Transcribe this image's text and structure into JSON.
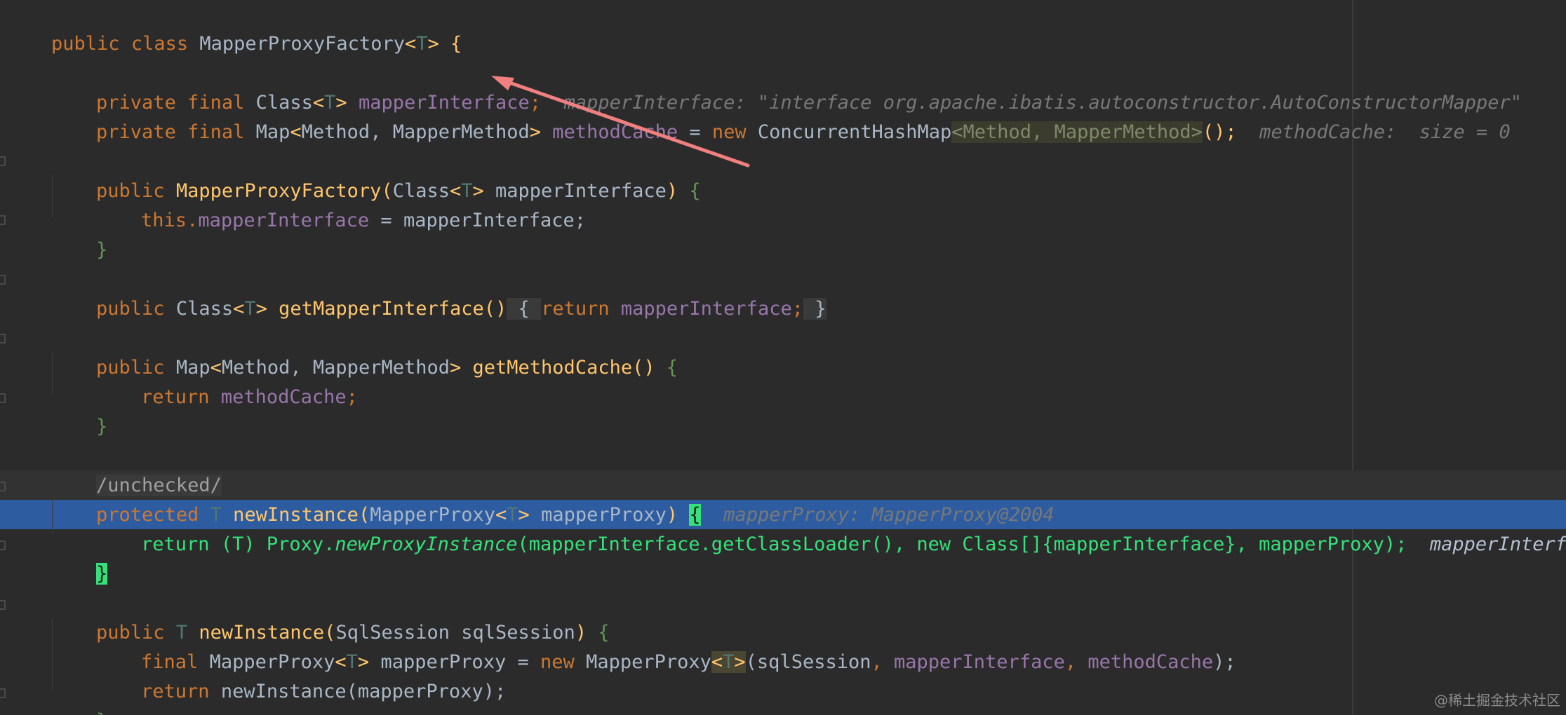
{
  "editor": {
    "colors": {
      "background": "#2b2b2b",
      "keyword": "#cc7832",
      "type": "#a9b7c6",
      "type_param": "#507874",
      "field": "#9876aa",
      "method": "#ffc66d",
      "hint": "#787878",
      "execution_line": "#2d5ca0",
      "execution_text": "#36e07a",
      "annotation_arrow": "#f08080"
    },
    "lines": {
      "class_decl": {
        "kw": "public class ",
        "name": "MapperProxyFactory",
        "lt": "<",
        "tparam": "T",
        "gt": ">",
        "rest": " {"
      },
      "field_iface": {
        "kw": "private final ",
        "type": "Class",
        "lt": "<",
        "tparam": "T",
        "gt": ">",
        "space": " ",
        "field": "mapperInterface",
        "semi": ";",
        "hint": "  mapperInterface: \"interface org.apache.ibatis.autoconstructor.AutoConstructorMapper\""
      },
      "field_cache": {
        "kw": "private final ",
        "type": "Map",
        "lt": "<",
        "type_args": "Method, MapperMethod",
        "gt": ">",
        "space": " ",
        "field": "methodCache",
        "eq": " = ",
        "new_kw": "new ",
        "ctor": "ConcurrentHashMap",
        "gen_args": "<Method, MapperMethod>",
        "tail": "();",
        "hint": "  methodCache:  size = 0"
      },
      "ctor_decl": {
        "kw": "public ",
        "name": "MapperProxyFactory",
        "open": "(",
        "ptype": "Class",
        "lt": "<",
        "tparam": "T",
        "gt": ">",
        "pname": " mapperInterface",
        "close": ") ",
        "brace": "{"
      },
      "ctor_body": {
        "this_kw": "this",
        "dot": ".",
        "field": "mapperInterface",
        "rest": " = mapperInterface;"
      },
      "ctor_end": {
        "brace": "}"
      },
      "getter_iface": {
        "kw": "public ",
        "type": "Class",
        "lt": "<",
        "tparam": "T",
        "gt": ">",
        "space": " ",
        "name": "getMapperInterface",
        "parens": "()",
        "fold_open": " { ",
        "ret_kw": "return ",
        "field": "mapperInterface",
        "semi": ";",
        "fold_close": " }"
      },
      "getter_cache": {
        "kw": "public ",
        "type": "Map",
        "lt": "<",
        "type_args": "Method, MapperMethod",
        "gt": ">",
        "space": " ",
        "name": "getMethodCache",
        "parens": "() ",
        "brace": "{"
      },
      "getter_cache_body": {
        "ret_kw": "return ",
        "field": "methodCache",
        "semi": ";"
      },
      "getter_cache_end": {
        "brace": "}"
      },
      "suppress": {
        "text": "/unchecked/"
      },
      "new_instance_1": {
        "kw": "protected ",
        "tparam": "T",
        "space": " ",
        "name": "newInstance",
        "open": "(",
        "ptype": "MapperProxy",
        "lt": "<",
        "tparam2": "T",
        "gt": ">",
        "pname": " mapperProxy",
        "close": ") ",
        "brace": "{",
        "hint": "  mapperProxy: MapperProxy@2004"
      },
      "exec_line": {
        "pre": "return (T) Proxy.",
        "method": "newProxyInstance",
        "post": "(mapperInterface.getClassLoader(), new Class[]{mapperInterface}, mapperProxy);",
        "hint": "  mapperInterface: \""
      },
      "new_instance_1_end": {
        "brace": "}"
      },
      "new_instance_2": {
        "kw": "public ",
        "tparam": "T",
        "space": " ",
        "name": "newInstance",
        "open": "(",
        "ptype": "SqlSession sqlSession",
        "close": ") ",
        "brace": "{"
      },
      "new_instance_2_body1": {
        "kw": "final ",
        "type": "MapperProxy",
        "lt": "<",
        "tparam": "T",
        "gt": ">",
        "var": " mapperProxy = ",
        "new_kw": "new ",
        "ctor": "MapperProxy",
        "gen_open": "<",
        "gen_t": "T",
        "gen_close": ">",
        "args_open": "(sqlSession",
        "comma1": ", ",
        "field1": "mapperInterface",
        "comma2": ", ",
        "field2": "methodCache",
        "args_close": ");"
      },
      "new_instance_2_body2": {
        "ret_kw": "return ",
        "rest": "newInstance(mapperProxy);"
      },
      "new_instance_2_end": {
        "brace": "}"
      }
    }
  },
  "watermark": {
    "text": "@稀土掘金技术社区"
  }
}
